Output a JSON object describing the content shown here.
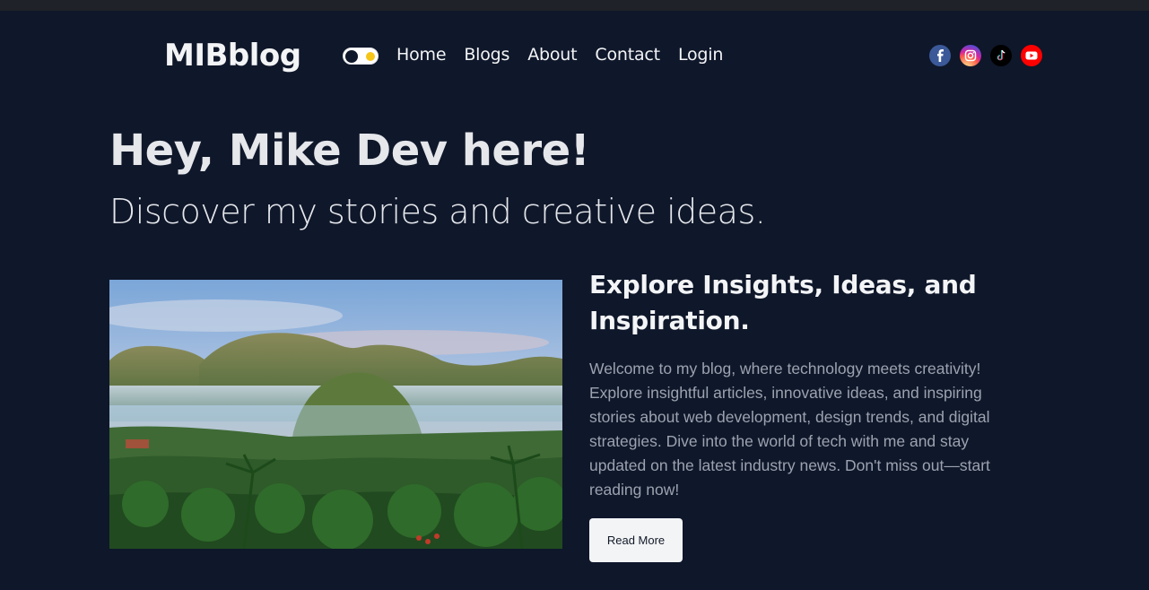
{
  "header": {
    "logo": "MIBblog",
    "theme_toggle": "theme-toggle",
    "nav": [
      "Home",
      "Blogs",
      "About",
      "Contact",
      "Login"
    ],
    "socials": [
      {
        "name": "facebook-icon",
        "color": "#3b5998"
      },
      {
        "name": "instagram-icon",
        "color": "#d6249f"
      },
      {
        "name": "tiktok-icon",
        "color": "#000000"
      },
      {
        "name": "youtube-icon",
        "color": "#ff0000"
      }
    ]
  },
  "hero": {
    "title": "Hey, Mike Dev here!",
    "subtitle": "Discover my stories and creative ideas."
  },
  "feature": {
    "image_icon": "landscape-photo",
    "title": "Explore Insights, Ideas, and Inspiration.",
    "body": "Welcome to my blog, where technology meets creativity! Explore insightful articles, innovative ideas, and inspiring stories about web development, design trends, and digital strategies. Dive into the world of tech with me and stay updated on the latest industry news. Don't miss out—start reading now!",
    "button_label": "Read More"
  },
  "colors": {
    "background": "#0f172a",
    "text": "#e5e7eb",
    "muted": "#9ca3af",
    "button": "#f3f4f6"
  }
}
